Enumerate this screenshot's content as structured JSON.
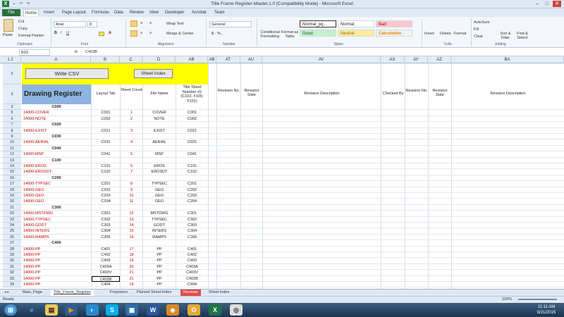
{
  "window": {
    "title": "Title Frame Register-Master.1.0 [Compatibility Mode] - Microsoft Excel",
    "app_icon": "X"
  },
  "menus": [
    "File",
    "Home",
    "Insert",
    "Page Layout",
    "Formulas",
    "Data",
    "Review",
    "View",
    "Developer",
    "Acrobat",
    "Team"
  ],
  "ribbon": {
    "clipboard": {
      "paste": "Paste",
      "cut": "Cut",
      "copy": "Copy",
      "painter": "Format Painter",
      "label": "Clipboard"
    },
    "font": {
      "name": "Arial",
      "size": "8",
      "label": "Font"
    },
    "alignment": {
      "wrap": "Wrap Text",
      "merge": "Merge & Center",
      "label": "Alignment"
    },
    "number": {
      "format": "General",
      "label": "Number"
    },
    "styles": {
      "cond": "Conditional Formatting",
      "table": "Format as Table",
      "normal_pq": "Normal_pq...",
      "normal": "Normal",
      "bad": "Bad",
      "good": "Good",
      "neutral": "Neutral",
      "calculation": "Calculation",
      "label": "Styles"
    },
    "cells": {
      "insert": "Insert",
      "delete": "Delete",
      "format": "Format",
      "label": "Cells"
    },
    "editing": {
      "autosum": "AutoSum",
      "fill": "Fill",
      "clear": "Clear",
      "sort": "Sort & Filter",
      "find": "Find & Select",
      "label": "Editing"
    }
  },
  "formula_bar": {
    "name_box": "B33",
    "fx": "fx",
    "value": "C403B"
  },
  "columns": [
    "A",
    "B",
    "C",
    "D",
    "AB",
    "AT",
    "AU",
    "AV",
    "AX",
    "AY",
    "AZ",
    "BA"
  ],
  "buttons": {
    "write_csv": "Write CSV",
    "sheet_index": "Sheet Index"
  },
  "header": {
    "title": "Drawing Register",
    "layout_tab": "Layout Tab",
    "sheet_count": "Sheet Count",
    "file_name": "File Name",
    "title_sheet": "Title Sheet Number #2 (C102, F100, F101)",
    "rev_no": "Revision No.",
    "rev_date": "Revision Date",
    "rev_desc": "Revision Description",
    "checked_by": "Checked By",
    "rev_no2": "Revision No.",
    "rev_date2": "Revision Date",
    "rev_desc2": "Revision Description"
  },
  "rows": [
    {
      "n": "3",
      "a": "C000",
      "b": "",
      "c": "",
      "d": "",
      "e": "",
      "sec": true
    },
    {
      "n": "5",
      "a": "14000-COVER",
      "b": "C001",
      "c": "1",
      "d": "COVER",
      "e": "C001"
    },
    {
      "n": "6",
      "a": "14000-NOTE",
      "b": "C002",
      "c": "2",
      "d": "NOTE",
      "e": "C002"
    },
    {
      "n": "7",
      "a": "C020",
      "b": "",
      "c": "",
      "d": "",
      "e": "",
      "sec": true
    },
    {
      "n": "8",
      "a": "14000-EXIST",
      "b": "C021",
      "c": "3",
      "d": "EXIST",
      "e": "C021"
    },
    {
      "n": "9",
      "a": "C030",
      "b": "",
      "c": "",
      "d": "",
      "e": "",
      "sec": true
    },
    {
      "n": "10",
      "a": "14000-AERIAL",
      "b": "C031",
      "c": "4",
      "d": "AERIAL",
      "e": "C031"
    },
    {
      "n": "11",
      "a": "C040",
      "b": "",
      "c": "",
      "d": "",
      "e": "",
      "sec": true
    },
    {
      "n": "12",
      "a": "14000-MSP",
      "b": "C041",
      "c": "5",
      "d": "MSP",
      "e": "C041"
    },
    {
      "n": "13",
      "a": "C100",
      "b": "",
      "c": "",
      "d": "",
      "e": "",
      "sec": true
    },
    {
      "n": "14",
      "a": "14000-EROS",
      "b": "C101",
      "c": "6",
      "d": "EROS",
      "e": "C101"
    },
    {
      "n": "15",
      "a": "14000-EROSDT",
      "b": "C102",
      "c": "7",
      "d": "EROSDT",
      "e": "C102"
    },
    {
      "n": "16",
      "a": "C200",
      "b": "",
      "c": "",
      "d": "",
      "e": "",
      "sec": true
    },
    {
      "n": "17",
      "a": "14000-TYPSEC",
      "b": "C201",
      "c": "8",
      "d": "TYPSEC",
      "e": "C201"
    },
    {
      "n": "18",
      "a": "14000-GEO",
      "b": "C202",
      "c": "9",
      "d": "GEO",
      "e": "C202"
    },
    {
      "n": "19",
      "a": "14000-GEO",
      "b": "C203",
      "c": "10",
      "d": "GEO",
      "e": "C203"
    },
    {
      "n": "20",
      "a": "14000-GEO",
      "b": "C204",
      "c": "11",
      "d": "GEO",
      "e": "C204"
    },
    {
      "n": "21",
      "a": "C300",
      "b": "",
      "c": "",
      "d": "",
      "e": "",
      "sec": true
    },
    {
      "n": "22",
      "a": "14000-MSTDWG",
      "b": "C301",
      "c": "12",
      "d": "MSTDWG",
      "e": "C301"
    },
    {
      "n": "23",
      "a": "14000-TYPSEC",
      "b": "C302",
      "c": "13",
      "d": "TYPSEC",
      "e": "C302"
    },
    {
      "n": "24",
      "a": "14000-GODT",
      "b": "C303",
      "c": "14",
      "d": "GODT",
      "e": "C303"
    },
    {
      "n": "25",
      "a": "14000-INTERS",
      "b": "C304",
      "c": "15",
      "d": "INTERS",
      "e": "C304"
    },
    {
      "n": "26",
      "a": "14000-RAMPS",
      "b": "C305",
      "c": "16",
      "d": "RAMPS",
      "e": "C305"
    },
    {
      "n": "27",
      "a": "C400",
      "b": "",
      "c": "",
      "d": "",
      "e": "",
      "sec": true
    },
    {
      "n": "28",
      "a": "14000-PP",
      "b": "C401",
      "c": "17",
      "d": "PP",
      "e": "C401"
    },
    {
      "n": "29",
      "a": "14000-PP",
      "b": "C402",
      "c": "18",
      "d": "PP",
      "e": "C402"
    },
    {
      "n": "30",
      "a": "14000-PP",
      "b": "C403",
      "c": "19",
      "d": "PP",
      "e": "C403"
    },
    {
      "n": "31",
      "a": "14000-PP",
      "b": "C403A",
      "c": "20",
      "d": "PP",
      "e": "C403A"
    },
    {
      "n": "32",
      "a": "14000-PP",
      "b": "C403V",
      "c": "21",
      "d": "PP",
      "e": "C403V"
    },
    {
      "n": "33",
      "a": "14000-PP",
      "b": "C403B",
      "c": "21",
      "d": "PP",
      "e": "C403B"
    },
    {
      "n": "34",
      "a": "14000-PP",
      "b": "C404",
      "c": "19",
      "d": "PP",
      "e": "C404"
    }
  ],
  "tabs": [
    "Main_Page",
    "Title_Frame_Register",
    "Proposers",
    "Planset Sheet Index",
    "Reviews",
    "Sheet Index"
  ],
  "status": {
    "mode": "Ready",
    "zoom": "100%"
  },
  "taskbar": {
    "time": "11:11 AM",
    "date": "9/21/2015"
  },
  "colors": {
    "accent": "#2a6f3a",
    "yellow": "#ffff00",
    "blue_hdr": "#8db4e2",
    "red_text": "#c00000"
  }
}
